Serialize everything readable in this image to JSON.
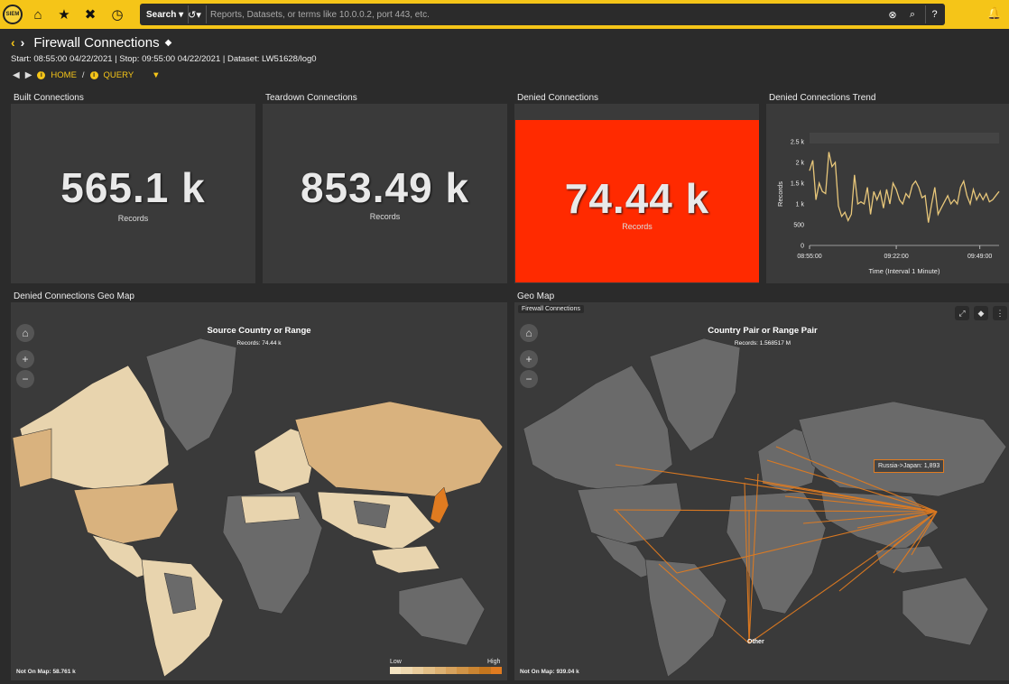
{
  "app": {
    "logo": "SIEM"
  },
  "topbar": {
    "search_label": "Search",
    "search_placeholder": "Reports, Datasets, or terms like 10.0.0.2, port 443, etc.",
    "icons": [
      "home-icon",
      "star-icon",
      "tools-icon",
      "clock-icon"
    ]
  },
  "header": {
    "title": "Firewall Connections",
    "meta": "Start: 08:55:00 04/22/2021 | Stop: 09:55:00 04/22/2021 | Dataset: LW51628/log0",
    "breadcrumb": {
      "home": "HOME",
      "sep": "/",
      "query": "QUERY"
    }
  },
  "panels": {
    "built": {
      "label": "Built Connections",
      "value": "565.1 k",
      "sub": "Records"
    },
    "teardown": {
      "label": "Teardown Connections",
      "value": "853.49 k",
      "sub": "Records"
    },
    "denied": {
      "label": "Denied Connections",
      "value": "74.44 k",
      "sub": "Records",
      "color": "#ff2a00"
    },
    "trend": {
      "label": "Denied Connections Trend",
      "xlabel": "Time (Interval 1 Minute)",
      "ylabel": "Records",
      "yticks": [
        "2.5 k",
        "2 k",
        "1.5 k",
        "1 k",
        "500",
        "0"
      ],
      "xticks": [
        "08:55:00",
        "09:22:00",
        "09:49:00"
      ]
    },
    "geo_left": {
      "label": "Denied Connections Geo Map",
      "title": "Source Country or Range",
      "records": "Records: 74.44 k",
      "not_on_map": "Not On Map: 58.761 k",
      "legend_low": "Low",
      "legend_high": "High"
    },
    "geo_right": {
      "label": "Geo Map",
      "chip": "Firewall Connections",
      "title": "Country Pair or Range Pair",
      "records": "Records: 1.568517 M",
      "not_on_map": "Not On Map: 939.04 k",
      "tooltip": "Russia->Japan: 1,893",
      "other": "Other"
    }
  },
  "chart_data": {
    "type": "line",
    "ylabel": "Records",
    "xlabel": "Time (Interval 1 Minute)",
    "ylim": [
      0,
      2500
    ],
    "x_ticks": [
      "08:55:00",
      "09:22:00",
      "09:49:00"
    ],
    "values": [
      1800,
      2050,
      1100,
      1500,
      1300,
      1250,
      2250,
      1900,
      2000,
      950,
      700,
      800,
      600,
      750,
      1700,
      1000,
      1050,
      1000,
      1400,
      750,
      1300,
      1100,
      1300,
      900,
      1350,
      1000,
      1500,
      1350,
      1100,
      1000,
      1250,
      1150,
      1450,
      1550,
      1400,
      1150,
      1200,
      550,
      1000,
      1400,
      750,
      900,
      1050,
      1200,
      1000,
      1100,
      1000,
      1400,
      1550,
      1200,
      1000,
      1350,
      1100,
      1250,
      1100,
      1250,
      1050,
      1100,
      1200,
      1300
    ]
  },
  "colors": {
    "accent": "#f5c518",
    "legend": [
      "#f3e3c2",
      "#eed8b0",
      "#e9cc9c",
      "#e3bf87",
      "#ddb172",
      "#d7a25d",
      "#d19447",
      "#cb8532",
      "#c5761e",
      "#e07b20"
    ]
  }
}
